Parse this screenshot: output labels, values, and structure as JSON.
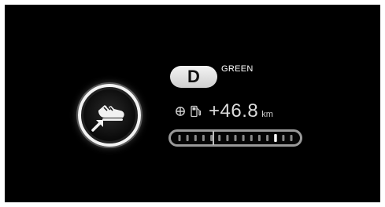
{
  "drive": {
    "gear": "D",
    "mode": "GREEN"
  },
  "eco_indicator": {
    "icon": "eco-shoe-icon",
    "color": "#f2f2f2"
  },
  "range": {
    "icons": [
      "target-icon",
      "fuel-pump-icon"
    ],
    "value": "+46.8",
    "unit": "km"
  },
  "efficiency_bar": {
    "segments": 15,
    "highlighted_segment": 13,
    "highlight_color": "#ffffff",
    "segment_color": "#8a8a8a"
  }
}
